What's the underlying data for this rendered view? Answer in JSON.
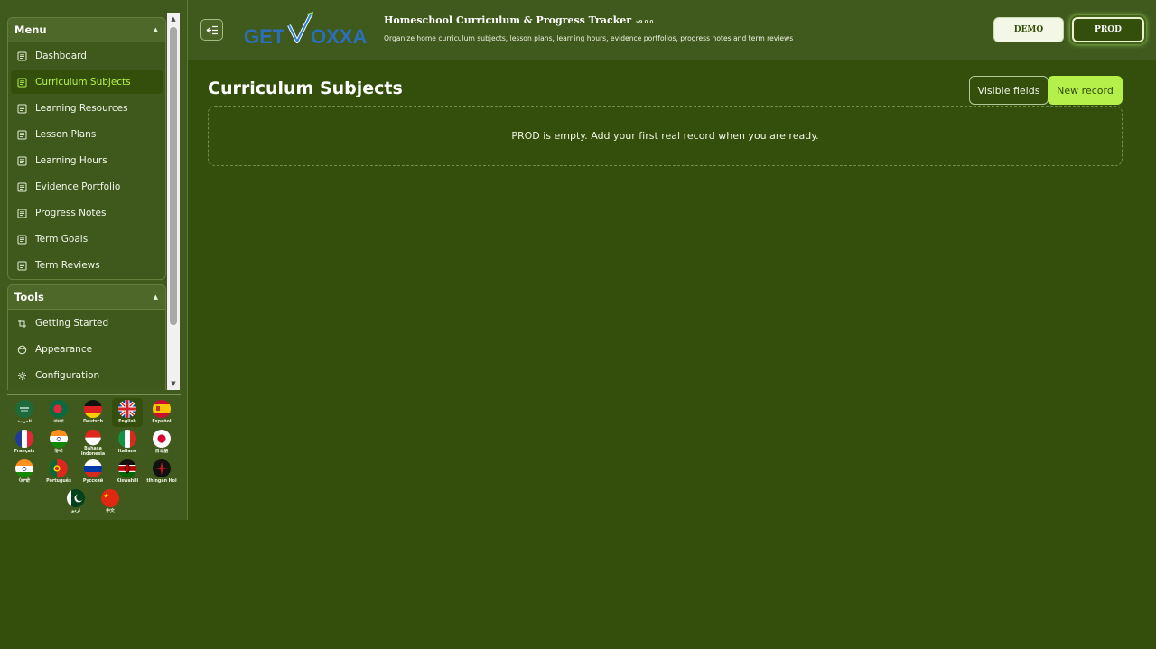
{
  "sidebar": {
    "menu_title": "Menu",
    "menu_items": [
      {
        "label": "Dashboard",
        "active": false
      },
      {
        "label": "Curriculum Subjects",
        "active": true
      },
      {
        "label": "Learning Resources",
        "active": false
      },
      {
        "label": "Lesson Plans",
        "active": false
      },
      {
        "label": "Learning Hours",
        "active": false
      },
      {
        "label": "Evidence Portfolio",
        "active": false
      },
      {
        "label": "Progress Notes",
        "active": false
      },
      {
        "label": "Term Goals",
        "active": false
      },
      {
        "label": "Term Reviews",
        "active": false
      }
    ],
    "tools_title": "Tools",
    "tools_items": [
      {
        "label": "Getting Started",
        "icon": "crop-icon"
      },
      {
        "label": "Appearance",
        "icon": "palette-icon"
      },
      {
        "label": "Configuration",
        "icon": "gear-icon"
      }
    ],
    "languages": [
      {
        "label": "العربية",
        "flag": "saudi-arabia"
      },
      {
        "label": "বাংলা",
        "flag": "bangladesh"
      },
      {
        "label": "Deutsch",
        "flag": "germany"
      },
      {
        "label": "English",
        "flag": "united-kingdom",
        "selected": true
      },
      {
        "label": "Español",
        "flag": "spain"
      },
      {
        "label": "Français",
        "flag": "france"
      },
      {
        "label": "हिन्दी",
        "flag": "india"
      },
      {
        "label": "Bahasa Indonesia",
        "flag": "indonesia"
      },
      {
        "label": "Italiano",
        "flag": "italy"
      },
      {
        "label": "日本語",
        "flag": "japan"
      },
      {
        "label": "ਪੰਜਾਬੀ",
        "flag": "india"
      },
      {
        "label": "Português",
        "flag": "portugal"
      },
      {
        "label": "Русский",
        "flag": "russia"
      },
      {
        "label": "Kiswahili",
        "flag": "kenya"
      },
      {
        "label": "tlhIngan Hol",
        "flag": "klingon"
      },
      {
        "label": "اردو",
        "flag": "pakistan"
      },
      {
        "label": "中文",
        "flag": "china"
      }
    ]
  },
  "header": {
    "logo_text_left": "GET",
    "logo_text_right": "OXXA",
    "title": "Homeschool Curriculum & Progress Tracker",
    "version": "v9.0.0",
    "subtitle": "Organize home curriculum subjects, lesson plans, learning hours, evidence portfolios, progress notes and term reviews",
    "env_demo": "DEMO",
    "env_prod": "PROD"
  },
  "main": {
    "page_title": "Curriculum Subjects",
    "visible_fields_label": "Visible fields",
    "new_record_label": "New record",
    "empty_message": "PROD is empty. Add your first real record when you are ready."
  },
  "colors": {
    "background": "#344f0c",
    "sidebar": "#405a1e",
    "accent": "#b5f04a",
    "active_text": "#b6f24a"
  }
}
